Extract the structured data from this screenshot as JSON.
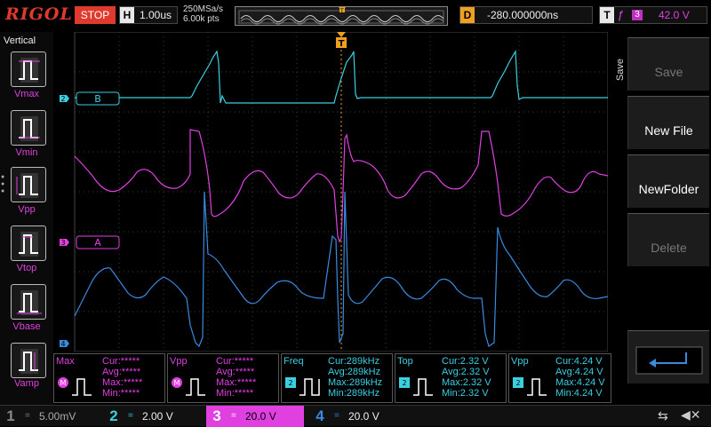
{
  "topbar": {
    "logo": "RIGOL",
    "run_state": "STOP",
    "horizontal_label": "H",
    "timebase": "1.00us",
    "sample_rate": "250MSa/s",
    "memory_depth": "6.00k pts",
    "delay_label": "D",
    "delay": "-280.000000ns",
    "trigger_label": "T",
    "trigger_source": "3",
    "trigger_level": "42.0 V"
  },
  "vertical_menu": {
    "title": "Vertical",
    "items": [
      "Vmax",
      "Vmin",
      "Vpp",
      "Vtop",
      "Vbase",
      "Vamp"
    ]
  },
  "channel_labels": {
    "b": "B",
    "a": "A",
    "ch2": "2",
    "ch3": "3",
    "ch4": "4",
    "trig_marker": "T"
  },
  "save_menu": {
    "title": "Save",
    "buttons": [
      {
        "label": "Save",
        "enabled": false
      },
      {
        "label": "New File",
        "enabled": true
      },
      {
        "label": "NewFolder",
        "enabled": true
      },
      {
        "label": "Delete",
        "enabled": false
      }
    ],
    "enter_icon": "return-arrow-icon"
  },
  "measurements": [
    {
      "name": "Max",
      "channel": "M",
      "color": "#e040e0",
      "cur": "Cur:*****",
      "avg": "Avg:*****",
      "max": "Max:*****",
      "min": "Min:*****"
    },
    {
      "name": "Vpp",
      "channel": "M",
      "color": "#e040e0",
      "cur": "Cur:*****",
      "avg": "Avg:*****",
      "max": "Max:*****",
      "min": "Min:*****"
    },
    {
      "name": "Freq",
      "channel": "2",
      "color": "#3ad0e0",
      "cur": "Cur:289kHz",
      "avg": "Avg:289kHz",
      "max": "Max:289kHz",
      "min": "Min:289kHz"
    },
    {
      "name": "Top",
      "channel": "2",
      "color": "#3ad0e0",
      "cur": "Cur:2.32 V",
      "avg": "Avg:2.32 V",
      "max": "Max:2.32 V",
      "min": "Min:2.32 V"
    },
    {
      "name": "Vpp",
      "channel": "2",
      "color": "#3ad0e0",
      "cur": "Cur:4.24 V",
      "avg": "Avg:4.24 V",
      "max": "Max:4.24 V",
      "min": "Min:4.24 V"
    }
  ],
  "channels": [
    {
      "num": "1",
      "coupling": "=",
      "scale": "5.00mV",
      "color": "#b0b030"
    },
    {
      "num": "2",
      "coupling": "=",
      "scale": "2.00 V",
      "color": "#3ad0e0"
    },
    {
      "num": "3",
      "coupling": "=",
      "scale": "20.0 V",
      "color": "#e040e0"
    },
    {
      "num": "4",
      "coupling": "=",
      "scale": "20.0 V",
      "color": "#3a8ae0"
    }
  ],
  "status_icons": [
    "usb-icon",
    "mute-icon"
  ],
  "colors": {
    "ch2": "#3ad0e0",
    "ch3": "#e040e0",
    "ch4": "#3a8ae0",
    "trigger": "#f0a020",
    "stop": "#e03a2e"
  }
}
